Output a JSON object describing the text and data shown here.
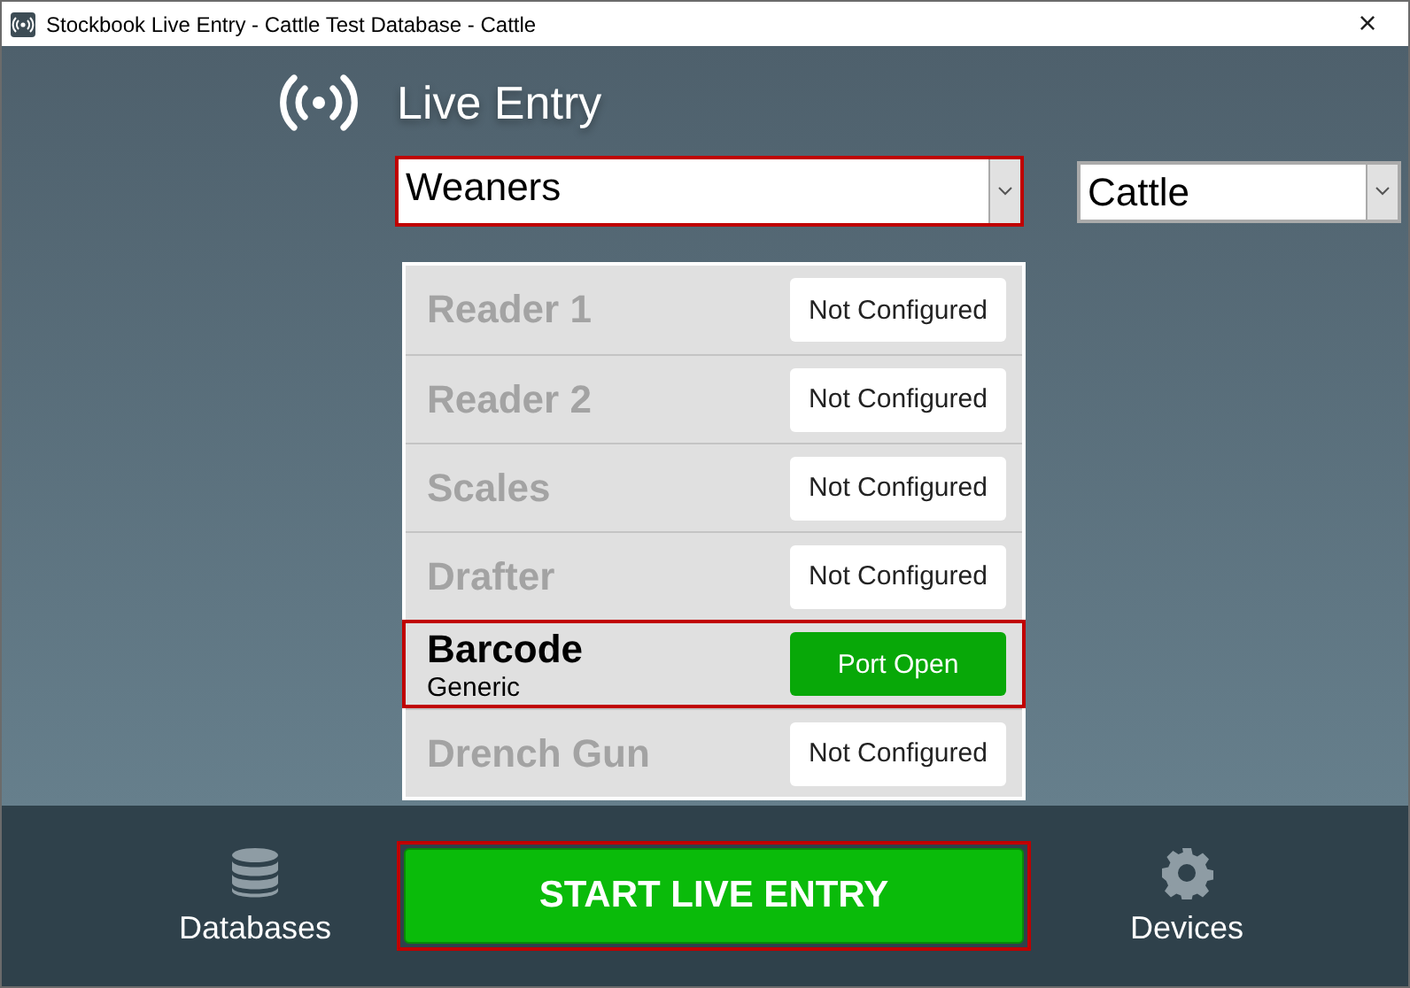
{
  "window": {
    "title": "Stockbook Live Entry - Cattle Test Database - Cattle",
    "close": "×"
  },
  "header": {
    "title": "Live Entry"
  },
  "session_select": {
    "value": "Weaners",
    "focused": true
  },
  "species_select": {
    "value": "Cattle",
    "focused": false
  },
  "devices": [
    {
      "name": "Reader 1",
      "configured": false,
      "selected": false,
      "status": "Not Configured",
      "kind": "idle"
    },
    {
      "name": "Reader 2",
      "configured": false,
      "selected": false,
      "status": "Not Configured",
      "kind": "idle"
    },
    {
      "name": "Scales",
      "configured": false,
      "selected": false,
      "status": "Not Configured",
      "kind": "idle"
    },
    {
      "name": "Drafter",
      "configured": false,
      "selected": false,
      "status": "Not Configured",
      "kind": "idle"
    },
    {
      "name": "Barcode",
      "subtitle": "Generic",
      "configured": true,
      "selected": true,
      "status": "Port Open",
      "kind": "open"
    },
    {
      "name": "Drench Gun",
      "configured": false,
      "selected": false,
      "status": "Not Configured",
      "kind": "idle"
    }
  ],
  "footer": {
    "left": "Databases",
    "start": "START LIVE ENTRY",
    "start_focused": true,
    "right": "Devices"
  }
}
